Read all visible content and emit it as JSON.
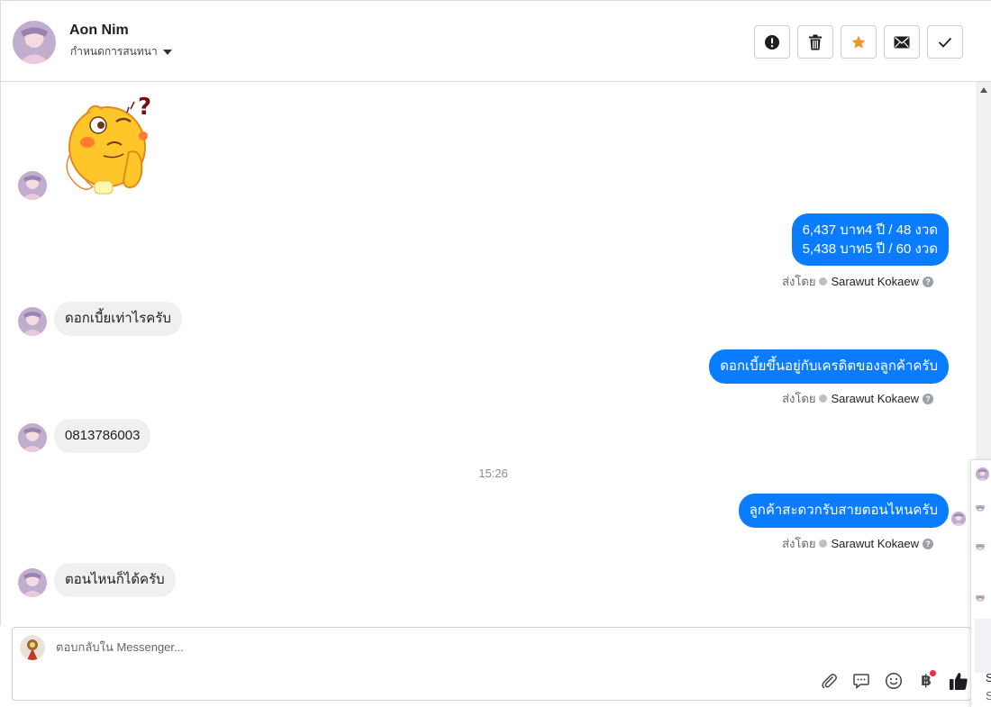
{
  "header": {
    "contact_name": "Aon Nim",
    "assign_label": "กำหนดการสนทนา",
    "toolbar": [
      {
        "icon": "exclamation-icon",
        "color": "#1c1e21"
      },
      {
        "icon": "trash-icon",
        "color": "#1c1e21"
      },
      {
        "icon": "star-icon",
        "color": "#f5922a"
      },
      {
        "icon": "envelope-icon",
        "color": "#1c1e21"
      },
      {
        "icon": "checkmark-icon",
        "color": "#1c1e21"
      }
    ]
  },
  "messages": [
    {
      "direction": "in",
      "type": "sticker",
      "sticker": "thinking-chick-sticker"
    },
    {
      "direction": "out",
      "lines": [
        "6,437 บาท4 ปี / 48 งวด",
        "5,438 บาท5 ปี / 60 งวด"
      ],
      "sent_by_label": "ส่งโดย",
      "sender": "Sarawut Kokaew"
    },
    {
      "direction": "in",
      "text": "ดอกเบี้ยเท่าไรครับ"
    },
    {
      "direction": "out",
      "text": "ดอกเบี้ยขึ้นอยู่กับเครดิตของลูกค้าครับ",
      "sent_by_label": "ส่งโดย",
      "sender": "Sarawut Kokaew"
    },
    {
      "direction": "in",
      "text": "0813786003"
    },
    {
      "direction": "separator",
      "time": "15:26"
    },
    {
      "direction": "out",
      "text": "ลูกค้าสะดวกรับสายตอนไหนครับ",
      "sent_by_label": "ส่งโดย",
      "sender": "Sarawut Kokaew"
    },
    {
      "direction": "in",
      "text": "ตอนไหนก็ได้ครับ"
    }
  ],
  "composer": {
    "placeholder": "ตอบกลับใน Messenger...",
    "tools": [
      "paperclip-icon",
      "saved-reply-icon",
      "emoji-icon",
      "baht-payment-icon",
      "thumbs-up-icon"
    ],
    "baht_symbol": "฿"
  },
  "side_panel": {
    "chars": [
      "S",
      "S"
    ]
  },
  "colors": {
    "outgoing_bubble": "#0a7cff",
    "incoming_bubble": "#f0f0f0",
    "notification_dot": "#f02849"
  }
}
